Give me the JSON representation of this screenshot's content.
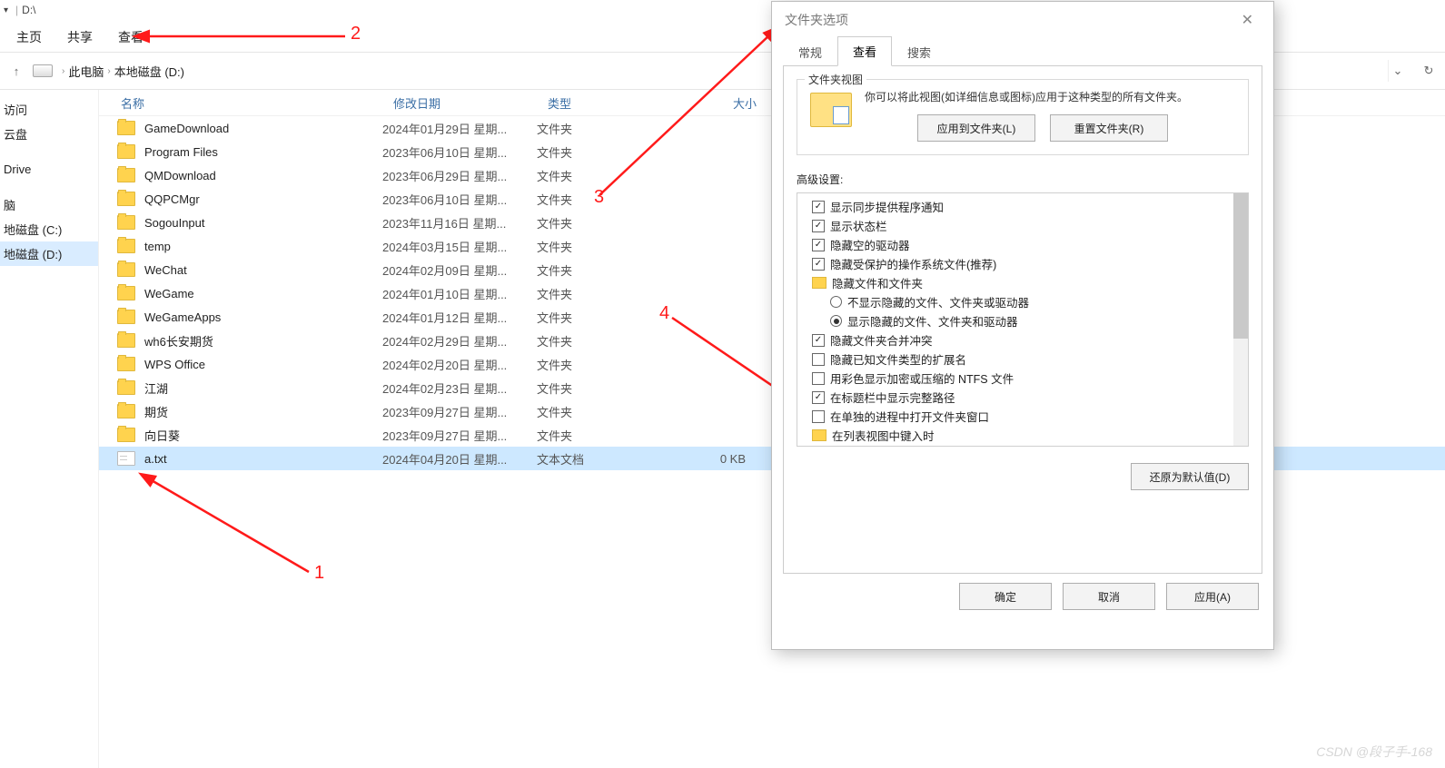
{
  "title_path": "D:\\",
  "ribbon": {
    "home": "主页",
    "share": "共享",
    "view": "查看"
  },
  "breadcrumb": {
    "pc": "此电脑",
    "drive": "本地磁盘 (D:)"
  },
  "sidebar": {
    "items": [
      {
        "label": "访问"
      },
      {
        "label": "云盘"
      },
      {
        "label": ""
      },
      {
        "label": "Drive"
      },
      {
        "label": ""
      },
      {
        "label": "脑"
      },
      {
        "label": "地磁盘 (C:)"
      },
      {
        "label": "地磁盘 (D:)"
      }
    ],
    "selected_index": 7
  },
  "columns": {
    "name": "名称",
    "date": "修改日期",
    "type": "类型",
    "size": "大小"
  },
  "rows": [
    {
      "icon": "folder",
      "name": "GameDownload",
      "date": "2024年01月29日 星期...",
      "type": "文件夹",
      "size": ""
    },
    {
      "icon": "folder",
      "name": "Program Files",
      "date": "2023年06月10日 星期...",
      "type": "文件夹",
      "size": ""
    },
    {
      "icon": "folder",
      "name": "QMDownload",
      "date": "2023年06月29日 星期...",
      "type": "文件夹",
      "size": ""
    },
    {
      "icon": "folder",
      "name": "QQPCMgr",
      "date": "2023年06月10日 星期...",
      "type": "文件夹",
      "size": ""
    },
    {
      "icon": "folder",
      "name": "SogouInput",
      "date": "2023年11月16日 星期...",
      "type": "文件夹",
      "size": ""
    },
    {
      "icon": "folder",
      "name": "temp",
      "date": "2024年03月15日 星期...",
      "type": "文件夹",
      "size": ""
    },
    {
      "icon": "folder",
      "name": "WeChat",
      "date": "2024年02月09日 星期...",
      "type": "文件夹",
      "size": ""
    },
    {
      "icon": "folder",
      "name": "WeGame",
      "date": "2024年01月10日 星期...",
      "type": "文件夹",
      "size": ""
    },
    {
      "icon": "folder",
      "name": "WeGameApps",
      "date": "2024年01月12日 星期...",
      "type": "文件夹",
      "size": ""
    },
    {
      "icon": "folder",
      "name": "wh6长安期货",
      "date": "2024年02月29日 星期...",
      "type": "文件夹",
      "size": ""
    },
    {
      "icon": "folder",
      "name": "WPS Office",
      "date": "2024年02月20日 星期...",
      "type": "文件夹",
      "size": ""
    },
    {
      "icon": "folder",
      "name": "江湖",
      "date": "2024年02月23日 星期...",
      "type": "文件夹",
      "size": ""
    },
    {
      "icon": "folder",
      "name": "期货",
      "date": "2023年09月27日 星期...",
      "type": "文件夹",
      "size": ""
    },
    {
      "icon": "folder",
      "name": "向日葵",
      "date": "2023年09月27日 星期...",
      "type": "文件夹",
      "size": ""
    },
    {
      "icon": "file",
      "name": "a.txt",
      "date": "2024年04月20日 星期...",
      "type": "文本文档",
      "size": "0 KB",
      "selected": true
    }
  ],
  "dialog": {
    "title": "文件夹选项",
    "tabs": {
      "general": "常规",
      "view": "查看",
      "search": "搜索"
    },
    "active_tab": "view",
    "group_view_title": "文件夹视图",
    "apply_text": "你可以将此视图(如详细信息或图标)应用于这种类型的所有文件夹。",
    "btn_apply_folders": "应用到文件夹(L)",
    "btn_reset_folders": "重置文件夹(R)",
    "advanced_label": "高级设置:",
    "tree": [
      {
        "kind": "check",
        "checked": true,
        "label": "显示同步提供程序通知"
      },
      {
        "kind": "check",
        "checked": true,
        "label": "显示状态栏"
      },
      {
        "kind": "check",
        "checked": true,
        "label": "隐藏空的驱动器"
      },
      {
        "kind": "check",
        "checked": true,
        "label": "隐藏受保护的操作系统文件(推荐)"
      },
      {
        "kind": "folder",
        "label": "隐藏文件和文件夹"
      },
      {
        "kind": "radio",
        "checked": false,
        "indent": true,
        "label": "不显示隐藏的文件、文件夹或驱动器"
      },
      {
        "kind": "radio",
        "checked": true,
        "indent": true,
        "label": "显示隐藏的文件、文件夹和驱动器"
      },
      {
        "kind": "check",
        "checked": true,
        "label": "隐藏文件夹合并冲突"
      },
      {
        "kind": "check",
        "checked": false,
        "label": "隐藏已知文件类型的扩展名"
      },
      {
        "kind": "check",
        "checked": false,
        "label": "用彩色显示加密或压缩的 NTFS 文件"
      },
      {
        "kind": "check",
        "checked": true,
        "label": "在标题栏中显示完整路径"
      },
      {
        "kind": "check",
        "checked": false,
        "label": "在单独的进程中打开文件夹窗口"
      },
      {
        "kind": "folder",
        "label": "在列表视图中键入时"
      }
    ],
    "btn_restore": "还原为默认值(D)",
    "btn_ok": "确定",
    "btn_cancel": "取消",
    "btn_apply": "应用(A)"
  },
  "annotations": {
    "n1": "1",
    "n2": "2",
    "n3": "3",
    "n4": "4"
  },
  "watermark": "CSDN @段子手-168"
}
